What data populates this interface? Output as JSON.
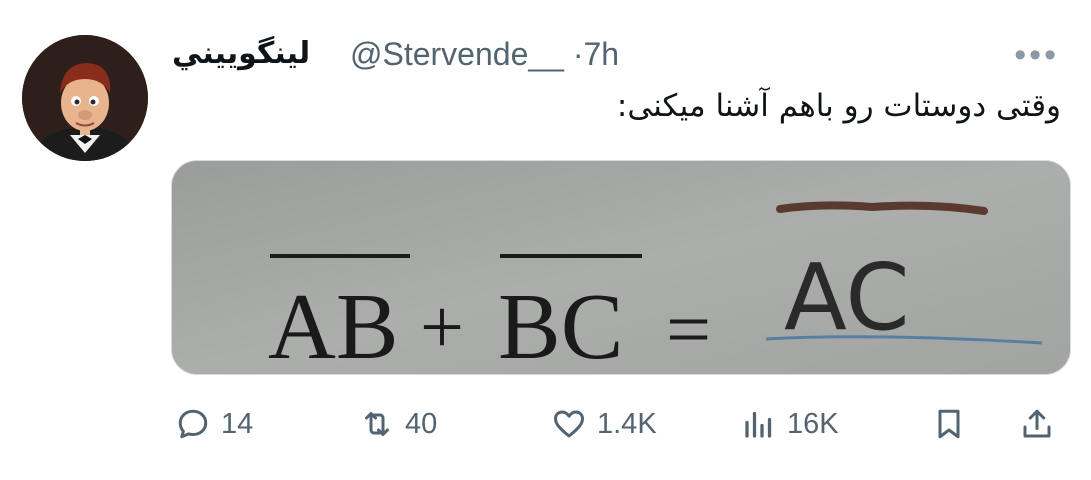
{
  "tweet": {
    "display_name": "لینگوییني",
    "handle": "@Stervende__",
    "separator": "·",
    "time": "7h",
    "more_label": "•••",
    "text": "وقتی دوستات رو باهم آشنا میکنی:",
    "avatar_icon": "animated-character-avatar"
  },
  "media": {
    "equation_printed": [
      "AB",
      "+",
      "BC",
      "="
    ],
    "handwritten": "AC"
  },
  "actions": {
    "reply": {
      "icon": "reply-icon",
      "count": "14"
    },
    "retweet": {
      "icon": "retweet-icon",
      "count": "40"
    },
    "like": {
      "icon": "heart-icon",
      "count": "1.4K"
    },
    "views": {
      "icon": "views-icon",
      "count": "16K"
    },
    "bookmark": {
      "icon": "bookmark-icon"
    },
    "share": {
      "icon": "share-icon"
    }
  },
  "colors": {
    "text": "#0f1419",
    "secondary": "#536471",
    "paper": "#a6a8a6"
  }
}
